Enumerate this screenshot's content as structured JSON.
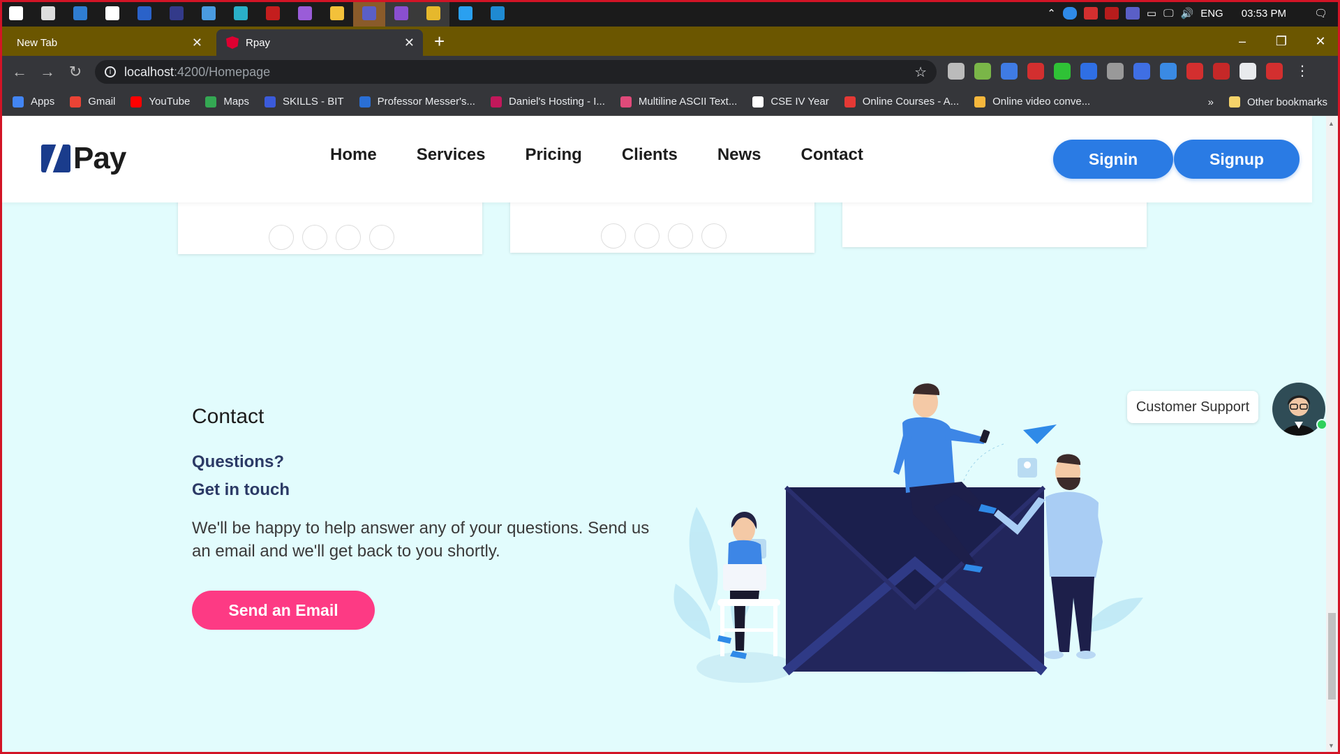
{
  "taskbar": {
    "apps": [
      {
        "icon": "windows-start-icon",
        "color": "#ffffff"
      },
      {
        "icon": "task-view-icon",
        "color": "#dddddd"
      },
      {
        "icon": "app-blue-icon",
        "color": "#2f7dd1"
      },
      {
        "icon": "notion-icon",
        "color": "#ffffff"
      },
      {
        "icon": "app-blue-icon",
        "color": "#2a62c9"
      },
      {
        "icon": "blackberry-icon",
        "color": "#333a8a"
      },
      {
        "icon": "photos-icon",
        "color": "#4a9be0"
      },
      {
        "icon": "edge-icon",
        "color": "#2ab0c8"
      },
      {
        "icon": "app-red-icon",
        "color": "#c41e1e"
      },
      {
        "icon": "visual-studio-icon",
        "color": "#9a5cd8"
      },
      {
        "icon": "file-explorer-icon",
        "color": "#f3c13a"
      },
      {
        "icon": "teams-icon",
        "color": "#5a5fc7"
      },
      {
        "icon": "visual-studio-icon",
        "color": "#8a4fd0"
      },
      {
        "icon": "chrome-icon",
        "color": "#e6b82c"
      },
      {
        "icon": "photoshop-icon",
        "color": "#2aa0f0"
      },
      {
        "icon": "vscode-icon",
        "color": "#1f8ad2"
      }
    ],
    "tray": {
      "lang": "ENG",
      "time": "03:53 PM"
    }
  },
  "tabs": [
    {
      "title": "New Tab"
    },
    {
      "title": "Rpay"
    }
  ],
  "address": {
    "host": "localhost",
    "path": ":4200/Homepage"
  },
  "bookmarks": [
    {
      "label": "Apps",
      "color": "#4285f4"
    },
    {
      "label": "Gmail",
      "color": "#ea4335"
    },
    {
      "label": "YouTube",
      "color": "#ff0000"
    },
    {
      "label": "Maps",
      "color": "#34a853"
    },
    {
      "label": "SKILLS - BIT",
      "color": "#3b5bdb"
    },
    {
      "label": "Professor Messer's...",
      "color": "#2a6fd6"
    },
    {
      "label": "Daniel's Hosting - I...",
      "color": "#c2185b"
    },
    {
      "label": "Multiline ASCII Text...",
      "color": "#e04a7a"
    },
    {
      "label": "CSE IV Year",
      "color": "#ffffff"
    },
    {
      "label": "Online Courses - A...",
      "color": "#e53935"
    },
    {
      "label": "Online video conve...",
      "color": "#f6b73c"
    }
  ],
  "bookmarks_more": "»",
  "other_bookmarks": "Other bookmarks",
  "site": {
    "logo_text": "Pay",
    "menu": [
      "Home",
      "Services",
      "Pricing",
      "Clients",
      "News",
      "Contact"
    ],
    "signin": "Signin",
    "signup": "Signup"
  },
  "contact": {
    "title": "Contact",
    "q1": "Questions?",
    "q2": "Get in touch",
    "desc": "We'll be happy to help answer any of your questions. Send us an email and we'll get back to you shortly.",
    "button": "Send an Email"
  },
  "support": {
    "label": "Customer Support"
  },
  "colors": {
    "accent_blue": "#2a7be4",
    "accent_pink": "#fd3a84",
    "page_bg": "#e2fcfd",
    "heading_navy": "#2b3a66"
  }
}
